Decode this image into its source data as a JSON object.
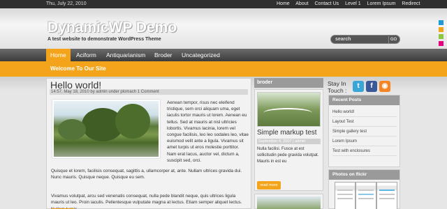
{
  "topbar": {
    "date": "Thu, July 22, 2010",
    "links": [
      "Home",
      "About",
      "Contact Us",
      "Level 1",
      "Lorem Ipsum",
      "Redirect"
    ]
  },
  "header": {
    "site_title": "DynamicWP Demo",
    "tagline": "A test website to demonstrate WordPress Theme",
    "search_placeholder": "search",
    "search_button": "GO",
    "swatch_colors": [
      "#1d9bd8",
      "#f3a41a",
      "#8dc63f",
      "#e6007e"
    ]
  },
  "nav": {
    "items": [
      "Home",
      "Aciform",
      "Antiquarianism",
      "Broder",
      "Uncategorized"
    ],
    "active": "Home",
    "accent": "#f3a41a"
  },
  "welcome": "Welcome To Our Site",
  "post": {
    "title": "Hello world!",
    "meta_time": "14:57, May 18, 2010 by ",
    "meta_author": "admin",
    "meta_under": " under ",
    "meta_category": "plomach",
    "meta_comments": "1 Comment",
    "para1": "Aenean tempor, risus nec eleifend tristique, sem orci aliquam uma, eget iaculis tortor mauris ut lorem. Aenean eu tellus. Sed at mauris at nisl ultricies lobortis. Vivamus lacinia, lorem vel congue facilisis, leo leo sodales leo, vitae euismod velit ante a ligula. Vivamus sit amet turpis ut eros molestie porttitor. Nam erat lacus, auctor vel, dictum a, suscipit sed, orci.",
    "para1_cont": "Quisque et lorem, facilisis consequat, sagittis a, ullamcorper at, ante. Nullam ultrices gravida dui. Nunc mauris. Quisque neque. Quisque eu sem.",
    "para2": "Vivamus volutpat, arcu sed venenatis consequat, nulla pede blandit neque, quis ultrices ligula mauris ut leo. Proin iaculis. Pellentesque vulputate magna at lectus. Etiam semper aliquet lectus. Nullam turpis."
  },
  "middle": {
    "header": "broder",
    "card_title": "Simple markup test",
    "card_meta": "September 4, 2007 | admin",
    "card_text": "Nulla facilisi. Fusce at est sollicitudin pede gravida volutpat. Mauris in est eu",
    "read_more": "read more"
  },
  "right": {
    "stay_in_touch": "Stay In Touch :",
    "social_icons": [
      "twitter-icon",
      "facebook-icon",
      "rss-icon"
    ],
    "recent_posts_header": "Recent Posts",
    "recent_posts": [
      "Hello world!",
      "Layout Test",
      "Simple gallery test",
      "Lorem Ipsum",
      "Test with enclosures"
    ],
    "flickr_header": "Photos on flickr"
  }
}
